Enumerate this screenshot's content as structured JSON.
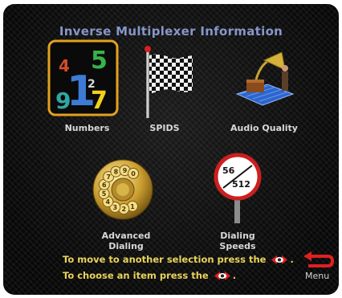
{
  "header": {
    "title": "Inverse Multiplexer Information"
  },
  "items": [
    {
      "label": "Numbers",
      "selected": true,
      "icon": "numbers-icon"
    },
    {
      "label": "SPIDS",
      "icon": "checkered-flag-icon"
    },
    {
      "label": "Audio Quality",
      "icon": "gramophone-icon"
    },
    {
      "label_line1": "Advanced",
      "label_line2": "Dialing",
      "icon": "rotary-dial-icon"
    },
    {
      "label_line1": "Dialing",
      "label_line2": "Speeds",
      "icon": "speed-sign-icon",
      "sign_top": "56",
      "sign_bottom": "512"
    }
  ],
  "numbers_icon": {
    "glyphs": [
      "4",
      "5",
      "1",
      "9",
      "2",
      "7"
    ]
  },
  "rotary_dial": {
    "digits": [
      "1",
      "2",
      "3",
      "4",
      "5",
      "6",
      "7",
      "8",
      "9",
      "0"
    ]
  },
  "footer": {
    "instruction1": "To move to another selection press the",
    "instruction2": "To choose an item press the",
    "menu_label": "Menu"
  },
  "colors": {
    "title": "#8597c9",
    "instructions": "#e9d45a",
    "selection_border": "#e3a11f",
    "back_arrow": "#e02020"
  }
}
